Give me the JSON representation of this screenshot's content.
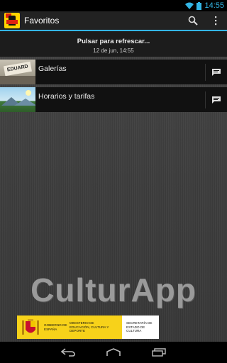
{
  "status_bar": {
    "time": "14:55",
    "icons": [
      "wifi-icon",
      "battery-icon"
    ]
  },
  "action_bar": {
    "title": "Favoritos",
    "actions": [
      "search-icon",
      "overflow-menu-icon"
    ]
  },
  "refresh_header": {
    "label": "Pulsar para refrescar...",
    "timestamp": "12 de jun, 14:55"
  },
  "list": {
    "items": [
      {
        "label": "Galerías",
        "thumb_sign": "EDUARD",
        "action_icon": "message-icon"
      },
      {
        "label": "Horarios y tarifas",
        "action_icon": "message-icon"
      }
    ]
  },
  "brand": {
    "name": "CulturApp"
  },
  "banner": {
    "gov": "GOBIERNO DE ESPAÑA",
    "ministry": "MINISTERIO DE EDUCACIÓN, CULTURA Y DEPORTE",
    "secretary": "SECRETARÍA DE ESTADO DE CULTURA"
  },
  "nav_bar": {
    "buttons": [
      "back-icon",
      "home-icon",
      "recent-apps-icon"
    ]
  },
  "colors": {
    "accent": "#33b5e5",
    "action_bar": "#222222",
    "list_item": "#111111"
  }
}
